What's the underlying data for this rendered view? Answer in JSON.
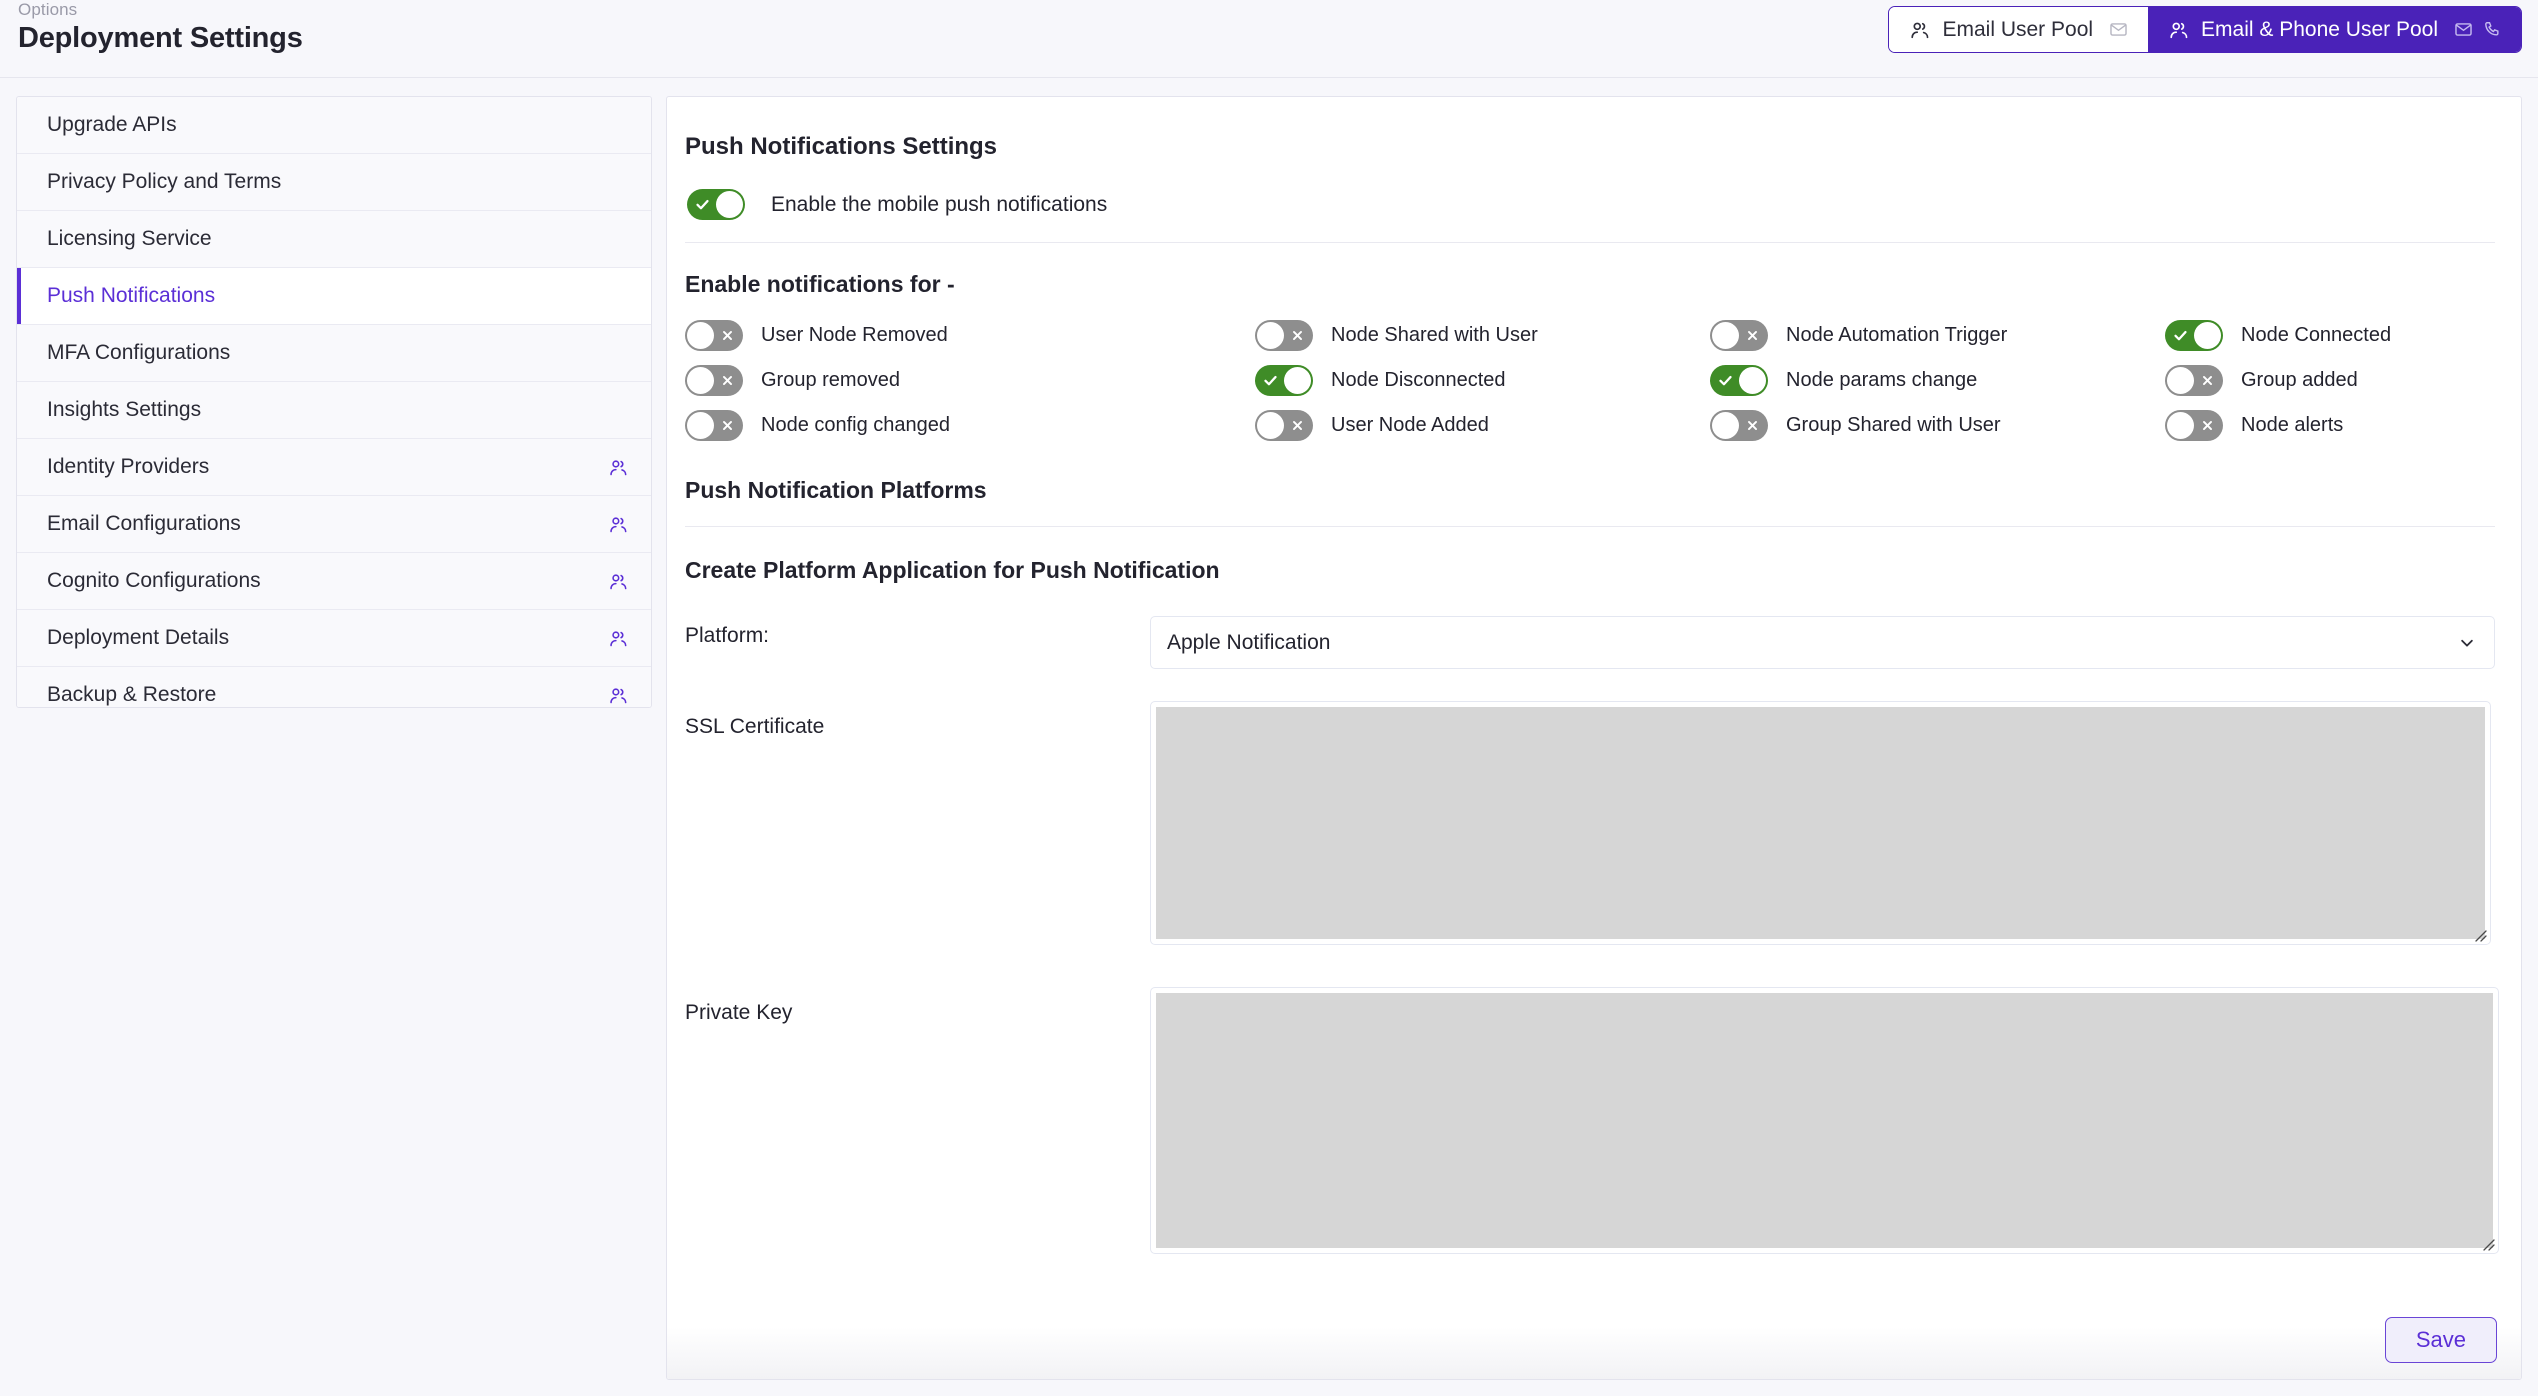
{
  "header": {
    "breadcrumb": "Options",
    "title": "Deployment Settings",
    "pools": [
      {
        "label": "Email User Pool",
        "active": false,
        "icons": [
          "users-icon",
          "envelope-icon"
        ]
      },
      {
        "label": "Email & Phone User Pool",
        "active": true,
        "icons": [
          "users-icon",
          "envelope-icon",
          "phone-icon"
        ]
      }
    ]
  },
  "sidebar": {
    "items": [
      {
        "label": "Upgrade APIs",
        "selected": false,
        "icon": null
      },
      {
        "label": "Privacy Policy and Terms",
        "selected": false,
        "icon": null
      },
      {
        "label": "Licensing Service",
        "selected": false,
        "icon": null
      },
      {
        "label": "Push Notifications",
        "selected": true,
        "icon": null
      },
      {
        "label": "MFA Configurations",
        "selected": false,
        "icon": null
      },
      {
        "label": "Insights Settings",
        "selected": false,
        "icon": null
      },
      {
        "label": "Identity Providers",
        "selected": false,
        "icon": "users-icon"
      },
      {
        "label": "Email Configurations",
        "selected": false,
        "icon": "users-icon"
      },
      {
        "label": "Cognito Configurations",
        "selected": false,
        "icon": "users-icon"
      },
      {
        "label": "Deployment Details",
        "selected": false,
        "icon": "users-icon"
      },
      {
        "label": "Backup & Restore",
        "selected": false,
        "icon": "users-icon"
      }
    ]
  },
  "main": {
    "push_settings_title": "Push Notifications Settings",
    "master_toggle": {
      "label": "Enable the mobile push notifications",
      "state": "on"
    },
    "notifications_title": "Enable notifications for -",
    "notifications": [
      {
        "label": "User Node Removed",
        "state": "off"
      },
      {
        "label": "Node Shared with User",
        "state": "off"
      },
      {
        "label": "Node Automation Trigger",
        "state": "off"
      },
      {
        "label": "Node Connected",
        "state": "on"
      },
      {
        "label": "Group removed",
        "state": "off"
      },
      {
        "label": "Node Disconnected",
        "state": "on"
      },
      {
        "label": "Node params change",
        "state": "on"
      },
      {
        "label": "Group added",
        "state": "off"
      },
      {
        "label": "Node config changed",
        "state": "off"
      },
      {
        "label": "User Node Added",
        "state": "off"
      },
      {
        "label": "Group Shared with User",
        "state": "off"
      },
      {
        "label": "Node alerts",
        "state": "off"
      }
    ],
    "platforms_title": "Push Notification Platforms",
    "create_platform_title": "Create Platform Application for Push Notification",
    "platform_label": "Platform:",
    "platform_value": "Apple Notification",
    "ssl_label": "SSL Certificate",
    "ssl_value": "",
    "private_key_label": "Private Key",
    "private_key_value": "",
    "save_label": "Save"
  },
  "colors": {
    "accent": "#5b2fd6",
    "active_pool": "#4a22b8",
    "toggle_on": "#3f8c27",
    "toggle_off": "#8e8e8e",
    "textarea_fill": "#d6d6d6"
  }
}
